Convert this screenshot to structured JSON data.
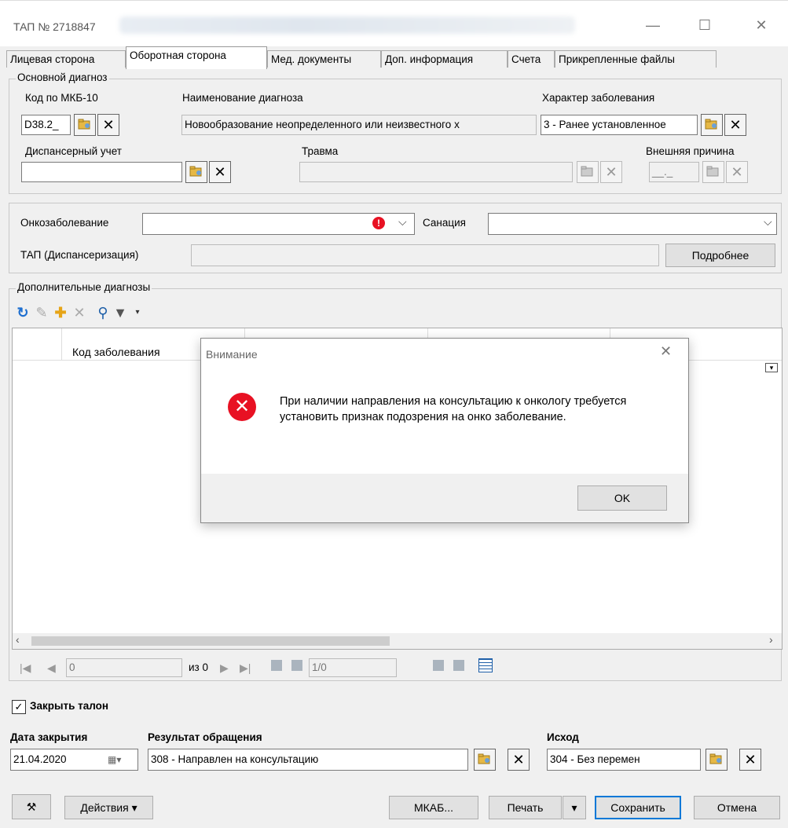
{
  "window": {
    "title": "ТАП № 2718847",
    "controls": {
      "minimize": "—",
      "maximize": "☐",
      "close": "✕"
    }
  },
  "tabs": [
    {
      "label": "Лицевая сторона"
    },
    {
      "label": "Оборотная сторона",
      "active": true
    },
    {
      "label": "Мед. документы"
    },
    {
      "label": "Доп. информация"
    },
    {
      "label": "Счета"
    },
    {
      "label": "Прикрепленные файлы"
    }
  ],
  "main_diagnosis": {
    "group_label": "Основной диагноз",
    "mkb_label": "Код по МКБ-10",
    "mkb_value": "D38.2_",
    "name_label": "Наименование диагноза",
    "name_value": "Новообразование неопределенного или неизвестного х",
    "character_label": "Характер заболевания",
    "character_value": "3 - Ранее установленное",
    "dispensary_label": "Диспансерный учет",
    "dispensary_value": "",
    "trauma_label": "Травма",
    "trauma_value": "",
    "external_label": "Внешняя причина",
    "external_value": "__._"
  },
  "onco": {
    "onco_label": "Онкозаболевание",
    "onco_value": "",
    "sanation_label": "Санация",
    "sanation_value": "",
    "tap_label": "ТАП (Диспансеризация)",
    "tap_value": "",
    "more_button": "Подробнее"
  },
  "additional": {
    "group_label": "Дополнительные диагнозы",
    "columns": [
      "Код заболевания"
    ],
    "rows": []
  },
  "pager": {
    "page_input": "0",
    "of_label": "из 0",
    "record_label": "1/0"
  },
  "dialog": {
    "title": "Внимание",
    "close": "✕",
    "message": "При наличии направления на консультацию к онкологу требуется установить признак подозрения на онко заболевание.",
    "ok_button": "OK"
  },
  "closing": {
    "close_checkbox_label": "Закрыть талон",
    "close_checked": true,
    "date_label": "Дата закрытия",
    "date_value": "21.04.2020",
    "result_label": "Результат обращения",
    "result_value": "308 - Направлен на консультацию",
    "outcome_label": "Исход",
    "outcome_value": "304 - Без перемен"
  },
  "bottom": {
    "actions": "Действия",
    "mkab": "МКАБ...",
    "print": "Печать",
    "save": "Сохранить",
    "cancel": "Отмена"
  },
  "colors": {
    "error_red": "#e81123",
    "accent_blue": "#0078d7",
    "window_bg": "#f0f0f0"
  }
}
